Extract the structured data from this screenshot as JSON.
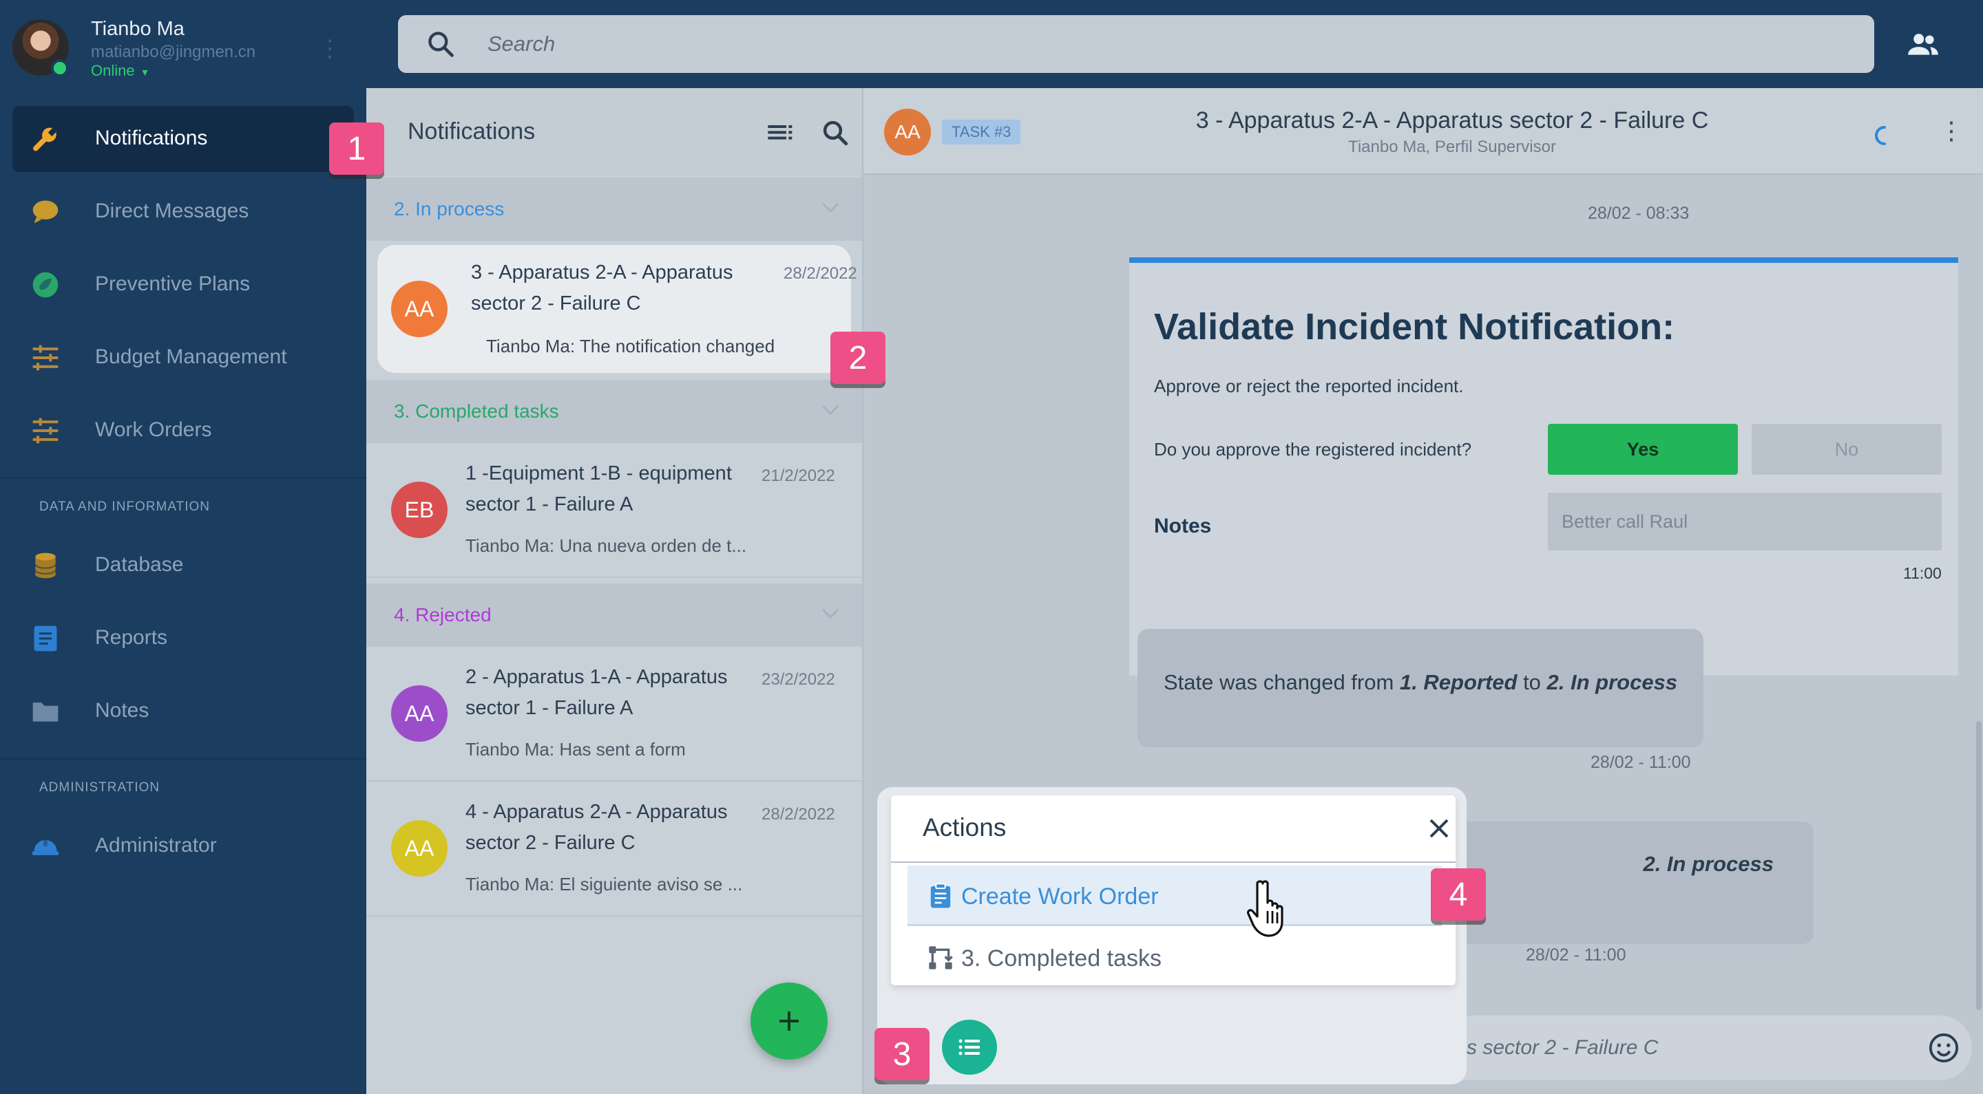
{
  "user": {
    "name": "Tianbo Ma",
    "email": "matianbo@jingmen.cn",
    "status": "Online"
  },
  "search": {
    "placeholder": "Search"
  },
  "sidebar": {
    "items": [
      {
        "label": "Notifications",
        "icon": "wrench-icon"
      },
      {
        "label": "Direct Messages",
        "icon": "chat-bubble-icon"
      },
      {
        "label": "Preventive Plans",
        "icon": "leaf-icon"
      },
      {
        "label": "Budget Management",
        "icon": "sliders-icon"
      },
      {
        "label": "Work Orders",
        "icon": "sliders-icon"
      }
    ],
    "section_data": "DATA AND INFORMATION",
    "data_items": [
      {
        "label": "Database",
        "icon": "database-icon"
      },
      {
        "label": "Reports",
        "icon": "report-icon"
      },
      {
        "label": "Notes",
        "icon": "folder-icon"
      }
    ],
    "section_admin": "ADMINISTRATION",
    "admin_items": [
      {
        "label": "Administrator",
        "icon": "helmet-icon"
      }
    ]
  },
  "list": {
    "title": "Notifications",
    "groups": {
      "in_process": {
        "label": "2. In process",
        "color": "#3a8fd8"
      },
      "completed": {
        "label": "3. Completed tasks",
        "color": "#2aa66a"
      },
      "rejected": {
        "label": "4. Rejected",
        "color": "#b03ad8"
      }
    },
    "items": [
      {
        "initials": "AA",
        "title": "3 - Apparatus 2-A - Apparatus sector 2 - Failure C",
        "date": "28/2/2022",
        "sub": "Tianbo Ma: The notification changed",
        "color": "#f07a3a"
      },
      {
        "initials": "EB",
        "title": "1 -Equipment 1-B - equipment sector 1 - Failure A",
        "date": "21/2/2022",
        "sub": "Tianbo Ma: Una nueva orden de t...",
        "color": "#d94f4f"
      },
      {
        "initials": "AA",
        "title": "2 - Apparatus 1-A - Apparatus sector 1 - Failure A",
        "date": "23/2/2022",
        "sub": "Tianbo Ma: Has sent a form",
        "color": "#9b4dca"
      },
      {
        "initials": "AA",
        "title": "4 - Apparatus 2-A - Apparatus sector 2 - Failure C",
        "date": "28/2/2022",
        "sub": "Tianbo Ma: El siguiente aviso se ...",
        "color": "#d6c422"
      }
    ]
  },
  "chat": {
    "avatar": "AA",
    "badge": "TASK #3",
    "title": "3 - Apparatus 2-A - Apparatus sector 2 - Failure C",
    "subtitle": "Tianbo Ma, Perfil Supervisor",
    "time1": "28/02 - 08:33",
    "form": {
      "title": "Validate Incident Notification:",
      "desc": "Approve or reject the reported incident.",
      "question": "Do you approve the registered incident?",
      "yes": "Yes",
      "no": "No",
      "notes_label": "Notes",
      "notes_value": "Better call Raul",
      "time": "11:00"
    },
    "state": {
      "prefix": "State was changed from ",
      "from": "1. Reported",
      "mid": " to ",
      "to": "2. In process"
    },
    "time2": "28/02 - 11:00",
    "state2_to": "2. In process",
    "time3": "28/02 - 11:00",
    "input_placeholder": "Send message to 3 - Apparatus 2-A - Apparatus sector 2 - Failure C"
  },
  "actions": {
    "title": "Actions",
    "items": [
      {
        "label": "Create Work Order",
        "icon": "clipboard-icon",
        "color": "#3a8fd8"
      },
      {
        "label": "3. Completed tasks",
        "icon": "flow-icon",
        "color": "#5a6673"
      }
    ]
  },
  "steps": [
    "1",
    "2",
    "3",
    "4"
  ]
}
